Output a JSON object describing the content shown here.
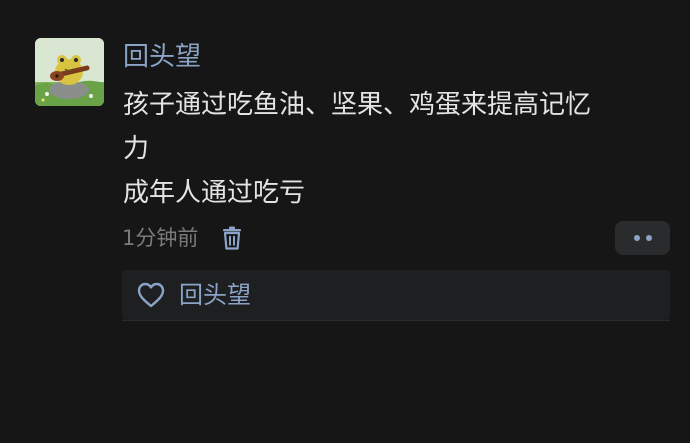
{
  "post": {
    "author": "回头望",
    "avatar_icon": "frog-with-guitar-avatar",
    "content_lines": [
      "孩子通过吃鱼油、坚果、鸡蛋来提高记忆",
      "力",
      "成年人通过吃亏"
    ],
    "time_ago": "1分钟前",
    "delete_icon": "trash-icon",
    "more_icon": "more-dots-icon"
  },
  "likes": {
    "heart_icon": "heart-icon",
    "users": [
      "回头望"
    ]
  },
  "colors": {
    "background": "#161616",
    "name_link": "#8aa3c6",
    "body_text": "#e4e4e4",
    "meta_text": "#7a7a7a",
    "panel": "#1e1f21"
  }
}
